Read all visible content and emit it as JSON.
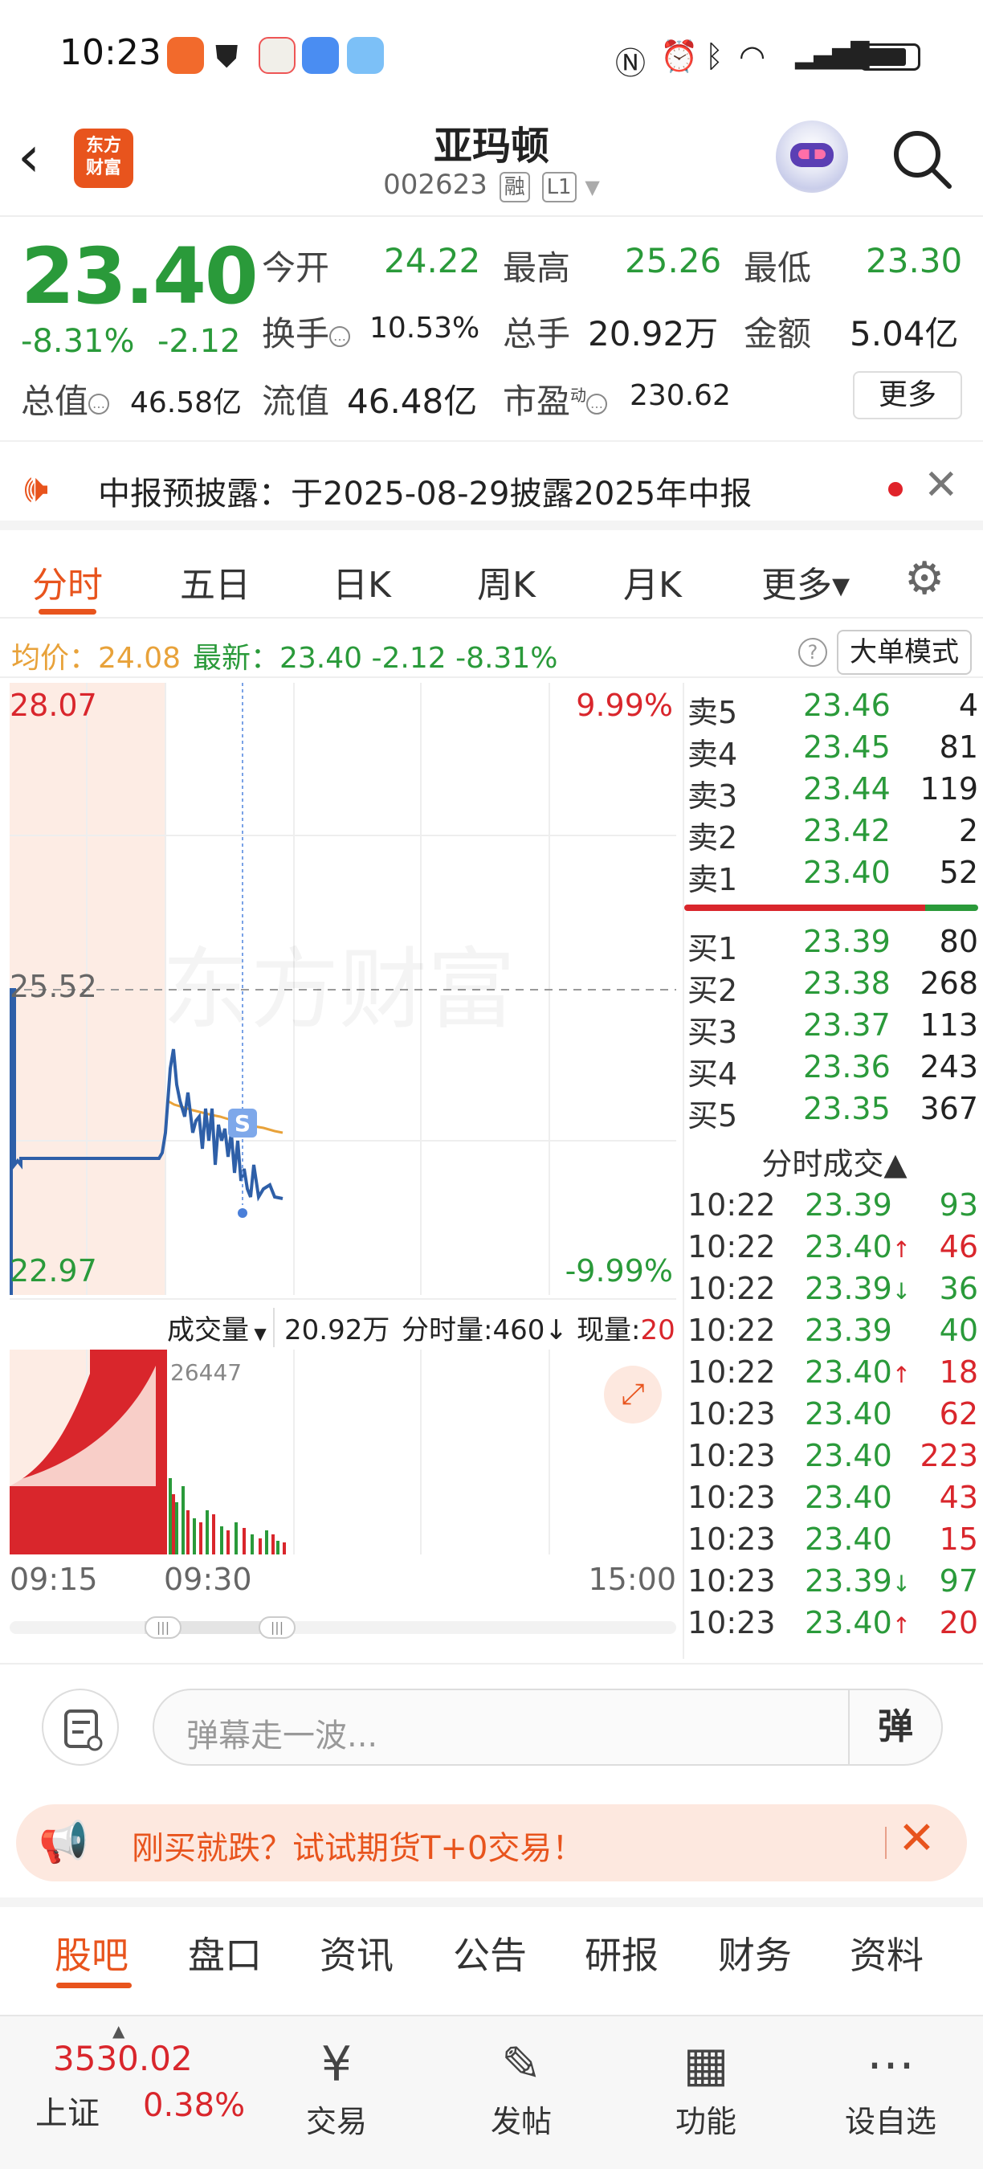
{
  "status_bar": {
    "time": "10:23"
  },
  "header": {
    "back": "‹",
    "logo_line1": "东方",
    "logo_line2": "财富",
    "stock_name": "亚玛顿",
    "stock_code": "002623",
    "tag_margin": "融",
    "tag_level": "L1"
  },
  "quote": {
    "price": "23.40",
    "change_pct": "-8.31%",
    "change": "-2.12",
    "open_label": "今开",
    "open": "24.22",
    "high_label": "最高",
    "high": "25.26",
    "low_label": "最低",
    "low": "23.30",
    "turnover_label": "换手",
    "turnover": "10.53%",
    "volume_label": "总手",
    "volume": "20.92万",
    "amount_label": "金额",
    "amount": "5.04亿",
    "mktcap_label": "总值",
    "mktcap": "46.58亿",
    "float_label": "流值",
    "float": "46.48亿",
    "pe_label": "市盈",
    "pe_sup": "动",
    "pe": "230.62",
    "more_btn": "更多"
  },
  "notice": {
    "text": "中报预披露：于2025-08-29披露2025年中报"
  },
  "chart_tabs": [
    "分时",
    "五日",
    "日K",
    "周K",
    "月K",
    "更多▾"
  ],
  "avg_row": {
    "avg_label": "均价：24.08",
    "latest_label": "最新：23.40  -2.12  -8.31%",
    "help": "?",
    "big_order_btn": "大单模式"
  },
  "chart": {
    "top_price": "28.07",
    "top_pct": "9.99%",
    "mid_price": "25.52",
    "bottom_price": "22.97",
    "bottom_pct": "-9.99%",
    "s_marker": "S",
    "watermark": "东方财富"
  },
  "volume": {
    "dropdown": "成交量",
    "total": "20.92万",
    "tick_label": "分时量:460↓",
    "now_label": "现量:",
    "now_value": "20",
    "peak_label": "26447"
  },
  "time_axis": {
    "start": "09:15",
    "mid": "09:30",
    "end": "15:00"
  },
  "order_book": {
    "asks": [
      {
        "label": "卖5",
        "price": "23.46",
        "vol": "4"
      },
      {
        "label": "卖4",
        "price": "23.45",
        "vol": "81"
      },
      {
        "label": "卖3",
        "price": "23.44",
        "vol": "119"
      },
      {
        "label": "卖2",
        "price": "23.42",
        "vol": "2"
      },
      {
        "label": "卖1",
        "price": "23.40",
        "vol": "52"
      }
    ],
    "bids": [
      {
        "label": "买1",
        "price": "23.39",
        "vol": "80"
      },
      {
        "label": "买2",
        "price": "23.38",
        "vol": "268"
      },
      {
        "label": "买3",
        "price": "23.37",
        "vol": "113"
      },
      {
        "label": "买4",
        "price": "23.36",
        "vol": "243"
      },
      {
        "label": "买5",
        "price": "23.35",
        "vol": "367"
      }
    ]
  },
  "trades": {
    "title": "分时成交▲",
    "rows": [
      {
        "time": "10:22",
        "price": "23.39",
        "arrow": "",
        "vol": "93",
        "vol_color": "#2a9a3a"
      },
      {
        "time": "10:22",
        "price": "23.40↑",
        "arrow": "up",
        "vol": "46",
        "vol_color": "#d9262c"
      },
      {
        "time": "10:22",
        "price": "23.39↓",
        "arrow": "down",
        "vol": "36",
        "vol_color": "#2a9a3a"
      },
      {
        "time": "10:22",
        "price": "23.39",
        "arrow": "",
        "vol": "40",
        "vol_color": "#2a9a3a"
      },
      {
        "time": "10:22",
        "price": "23.40↑",
        "arrow": "up",
        "vol": "18",
        "vol_color": "#d9262c"
      },
      {
        "time": "10:23",
        "price": "23.40",
        "arrow": "",
        "vol": "62",
        "vol_color": "#d9262c"
      },
      {
        "time": "10:23",
        "price": "23.40",
        "arrow": "",
        "vol": "223",
        "vol_color": "#d9262c"
      },
      {
        "time": "10:23",
        "price": "23.40",
        "arrow": "",
        "vol": "43",
        "vol_color": "#d9262c"
      },
      {
        "time": "10:23",
        "price": "23.40",
        "arrow": "",
        "vol": "15",
        "vol_color": "#d9262c"
      },
      {
        "time": "10:23",
        "price": "23.39↓",
        "arrow": "down",
        "vol": "97",
        "vol_color": "#2a9a3a"
      },
      {
        "time": "10:23",
        "price": "23.40↑",
        "arrow": "up",
        "vol": "20",
        "vol_color": "#d9262c"
      }
    ]
  },
  "danmu": {
    "placeholder": "弹幕走一波...",
    "button": "弹"
  },
  "ad": {
    "text": "刚买就跌？试试期货T+0交易！"
  },
  "bottom_tabs": [
    "股吧",
    "盘口",
    "资讯",
    "公告",
    "研报",
    "财务",
    "资料"
  ],
  "bottom_bar": {
    "index_value": "3530.02",
    "index_name": "上证",
    "index_pct": "0.38%",
    "nav": [
      {
        "label": "交易",
        "icon": "yen-circle-icon"
      },
      {
        "label": "发帖",
        "icon": "edit-icon"
      },
      {
        "label": "功能",
        "icon": "grid-icon"
      },
      {
        "label": "设自选",
        "icon": "more-circle-icon"
      }
    ]
  },
  "colors": {
    "accent": "#e8541d",
    "up": "#d9262c",
    "down": "#2a9a3a",
    "avg_line": "#e8a23a",
    "price_line": "#2e5fa8"
  }
}
